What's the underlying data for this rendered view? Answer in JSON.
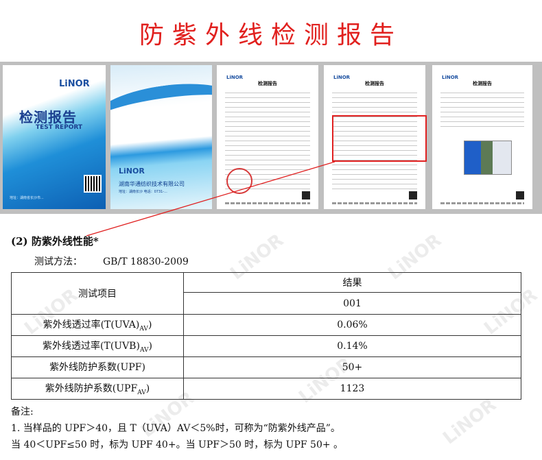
{
  "page_title": "防紫外线检测报告",
  "thumbnails": {
    "cover1": {
      "logo": "LiNOR",
      "title_cn": "检测报告",
      "title_en": "TEST REPORT",
      "footer": "地址：湖南省长沙市..."
    },
    "cover2": {
      "logo": "LiNOR",
      "company": "湖南华通纺织技术有限公司",
      "address": "地址：湖南长沙 电话：0731-..."
    },
    "page3_title": "检测报告",
    "page4_title": "检测报告",
    "page5_title": "检测报告",
    "logo_small": "LiNOR"
  },
  "section": {
    "heading": "(2)  防紫外线性能*",
    "method_label": "测试方法：",
    "method_value": "GB/T 18830-2009"
  },
  "table": {
    "col1_header": "测试项目",
    "result_header": "结果",
    "sample_id": "001",
    "rows": [
      {
        "item_prefix": "紫外线透过率(T(UVA)",
        "item_sub": "AV",
        "item_suffix": ")",
        "value": "0.06%"
      },
      {
        "item_prefix": "紫外线透过率(T(UVB)",
        "item_sub": "AV",
        "item_suffix": ")",
        "value": "0.14%"
      },
      {
        "item_prefix": "紫外线防护系数(UPF)",
        "item_sub": "",
        "item_suffix": "",
        "value": "50+"
      },
      {
        "item_prefix": "紫外线防护系数(UPF",
        "item_sub": "AV",
        "item_suffix": ")",
        "value": "1123"
      }
    ]
  },
  "notes": {
    "label": "备注:",
    "line1": "1.   当样品的 UPF＞40，且 T（UVA）AV＜5%时，可称为“防紫外线产品”。",
    "line2": "当 40＜UPF≤50 时，标为 UPF 40+。当 UPF＞50 时，标为 UPF 50+  。"
  },
  "watermark": "LiNOR",
  "colors": {
    "title_red": "#e1201e",
    "highlight_red": "#e02020",
    "brand_blue": "#1a4fa0"
  }
}
